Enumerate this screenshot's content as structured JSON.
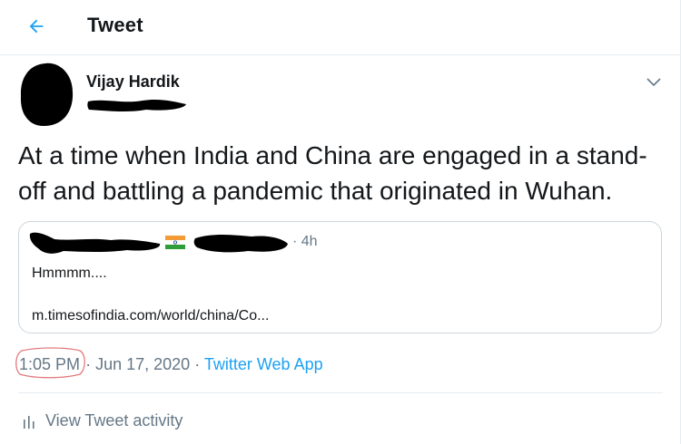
{
  "header": {
    "back_icon": "arrow-left-icon",
    "title": "Tweet",
    "accent_color": "#1da1f2"
  },
  "author": {
    "name": "Vijay Hardik",
    "avatar": "redacted",
    "handle": "redacted"
  },
  "tweet": {
    "text": "At a time when India and China are engaged in a stand-off and battling a pandemic that originated in Wuhan.",
    "time": "1:05 PM",
    "separator": "·",
    "date": "Jun 17, 2020",
    "source": "Twitter Web App"
  },
  "quoted_tweet": {
    "name": "redacted",
    "flag_icon": "india-flag-icon",
    "handle": "redacted",
    "time_ago": "· 4h",
    "text": "Hmmmm....",
    "link": "m.timesofindia.com/world/china/Co..."
  },
  "activity": {
    "icon": "bar-chart-icon",
    "label": "View Tweet activity"
  },
  "colors": {
    "text": "#14171a",
    "muted": "#657786",
    "link": "#1da1f2",
    "border": "#e6ecf0",
    "annotation": "#e3787a"
  }
}
